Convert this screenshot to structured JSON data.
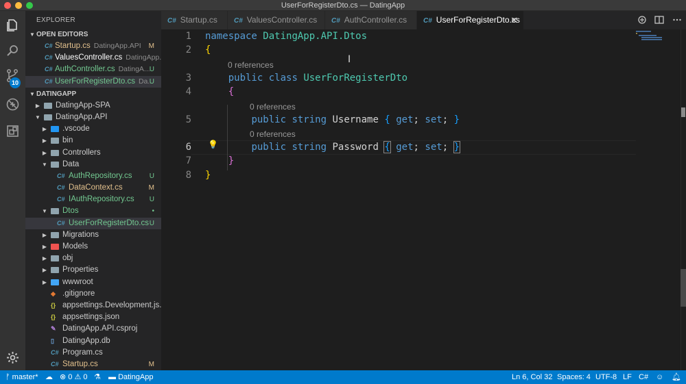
{
  "window": {
    "title": "UserForRegisterDto.cs — DatingApp"
  },
  "activity_bar": {
    "items": [
      "files-icon",
      "search-icon",
      "source-control-icon",
      "debug-icon",
      "extensions-icon"
    ],
    "scm_badge": "10",
    "settings_icon": "gear-icon"
  },
  "sidebar": {
    "title": "EXPLORER",
    "open_editors_label": "OPEN EDITORS",
    "open_editors": [
      {
        "name": "Startup.cs",
        "desc": "DatingApp.API",
        "status": "M"
      },
      {
        "name": "ValuesController.cs",
        "desc": "DatingApp....",
        "status": ""
      },
      {
        "name": "AuthController.cs",
        "desc": "DatingA...",
        "status": "U"
      },
      {
        "name": "UserForRegisterDto.cs",
        "desc": "Da...",
        "status": "U"
      }
    ],
    "workspace_label": "DATINGAPP",
    "tree": [
      {
        "name": "DatingApp-SPA",
        "status": ""
      },
      {
        "name": "DatingApp.API",
        "status": ""
      },
      {
        "name": ".vscode",
        "status": ""
      },
      {
        "name": "bin",
        "status": ""
      },
      {
        "name": "Controllers",
        "status": ""
      },
      {
        "name": "Data",
        "status": ""
      },
      {
        "name": "AuthRepository.cs",
        "status": "U"
      },
      {
        "name": "DataContext.cs",
        "status": "M"
      },
      {
        "name": "IAuthRepository.cs",
        "status": "U"
      },
      {
        "name": "Dtos",
        "status": "•"
      },
      {
        "name": "UserForRegisterDto.cs",
        "status": "U"
      },
      {
        "name": "Migrations",
        "status": ""
      },
      {
        "name": "Models",
        "status": ""
      },
      {
        "name": "obj",
        "status": ""
      },
      {
        "name": "Properties",
        "status": ""
      },
      {
        "name": "wwwroot",
        "status": ""
      },
      {
        "name": ".gitignore",
        "status": ""
      },
      {
        "name": "appsettings.Development.js...",
        "status": ""
      },
      {
        "name": "appsettings.json",
        "status": ""
      },
      {
        "name": "DatingApp.API.csproj",
        "status": ""
      },
      {
        "name": "DatingApp.db",
        "status": ""
      },
      {
        "name": "Program.cs",
        "status": ""
      },
      {
        "name": "Startup.cs",
        "status": "M"
      }
    ]
  },
  "tabs": [
    {
      "label": "Startup.cs",
      "icon": "C#"
    },
    {
      "label": "ValuesController.cs",
      "icon": "C#"
    },
    {
      "label": "AuthController.cs",
      "icon": "C#"
    },
    {
      "label": "UserForRegisterDto.cs",
      "icon": "C#",
      "active": true
    }
  ],
  "editor": {
    "line_numbers": [
      "1",
      "2",
      "3",
      "4",
      "5",
      "6",
      "7",
      "8"
    ],
    "lens": "0 references",
    "tokens": {
      "namespace": "namespace",
      "ns_name": "DatingApp.API.Dtos",
      "public": "public",
      "class": "class",
      "class_name": "UserForRegisterDto",
      "string": "string",
      "prop1": "Username",
      "prop2": "Password",
      "get": "get",
      "set": "set",
      "open_brace": "{",
      "close_brace": "}",
      "semicolon": ";"
    }
  },
  "statusbar": {
    "branch": "master*",
    "errors": "0",
    "warnings": "0",
    "folder": "DatingApp",
    "cursor": "Ln 6, Col 32",
    "spaces": "Spaces: 4",
    "encoding": "UTF-8",
    "eol": "LF",
    "language": "C#"
  }
}
